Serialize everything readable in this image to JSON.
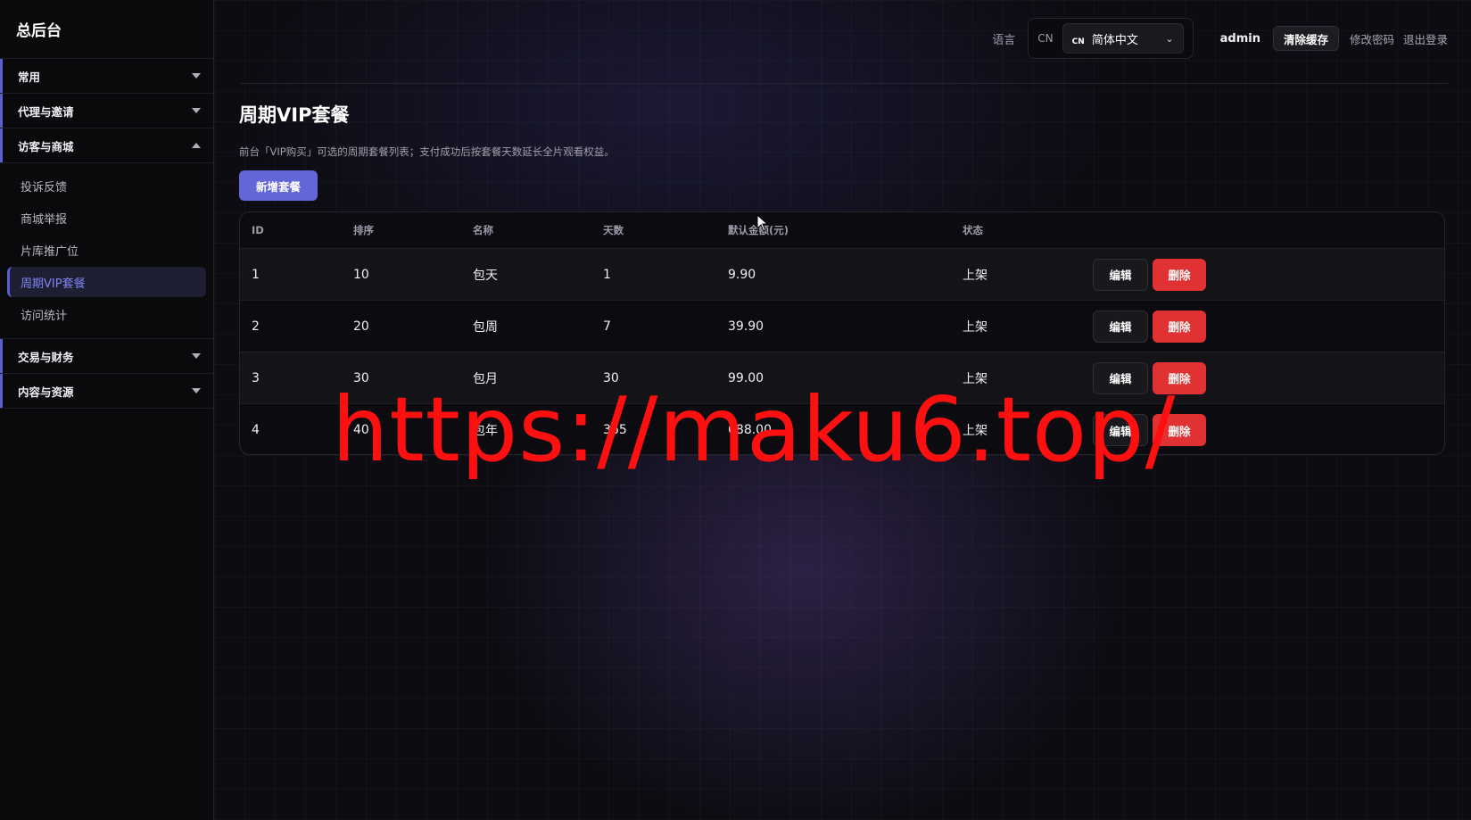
{
  "brand": "总后台",
  "sidebar": {
    "groups_before": [
      {
        "label": "常用"
      },
      {
        "label": "代理与邀请"
      }
    ],
    "open_group": {
      "label": "访客与商城",
      "items": [
        {
          "label": "投诉反馈"
        },
        {
          "label": "商城举报"
        },
        {
          "label": "片库推广位"
        },
        {
          "label": "周期VIP套餐",
          "active": true
        },
        {
          "label": "访问统计"
        }
      ]
    },
    "groups_after": [
      {
        "label": "交易与财务"
      },
      {
        "label": "内容与资源"
      }
    ]
  },
  "header": {
    "lang_label": "语言",
    "lang_code": "CN",
    "lang_flag": "CN",
    "lang_value": "简体中文",
    "admin_name": "admin",
    "clear_cache": "清除缓存",
    "change_password": "修改密码",
    "logout": "退出登录"
  },
  "page": {
    "title": "周期VIP套餐",
    "description": "前台「VIP购买」可选的周期套餐列表；支付成功后按套餐天数延长全片观看权益。",
    "add_button": "新增套餐"
  },
  "table": {
    "columns": [
      "ID",
      "排序",
      "名称",
      "天数",
      "默认金额(元)",
      "状态"
    ],
    "rows": [
      {
        "id": "1",
        "sort": "10",
        "name": "包天",
        "days": "1",
        "amount": "9.90",
        "status": "上架"
      },
      {
        "id": "2",
        "sort": "20",
        "name": "包周",
        "days": "7",
        "amount": "39.90",
        "status": "上架"
      },
      {
        "id": "3",
        "sort": "30",
        "name": "包月",
        "days": "30",
        "amount": "99.00",
        "status": "上架"
      },
      {
        "id": "4",
        "sort": "40",
        "name": "包年",
        "days": "365",
        "amount": "688.00",
        "status": "上架"
      }
    ],
    "edit_label": "编辑",
    "delete_label": "删除"
  },
  "watermark": "https://maku6.top/",
  "colors": {
    "accent": "#6366d6",
    "danger": "#e03232",
    "watermark": "#ff1010"
  }
}
